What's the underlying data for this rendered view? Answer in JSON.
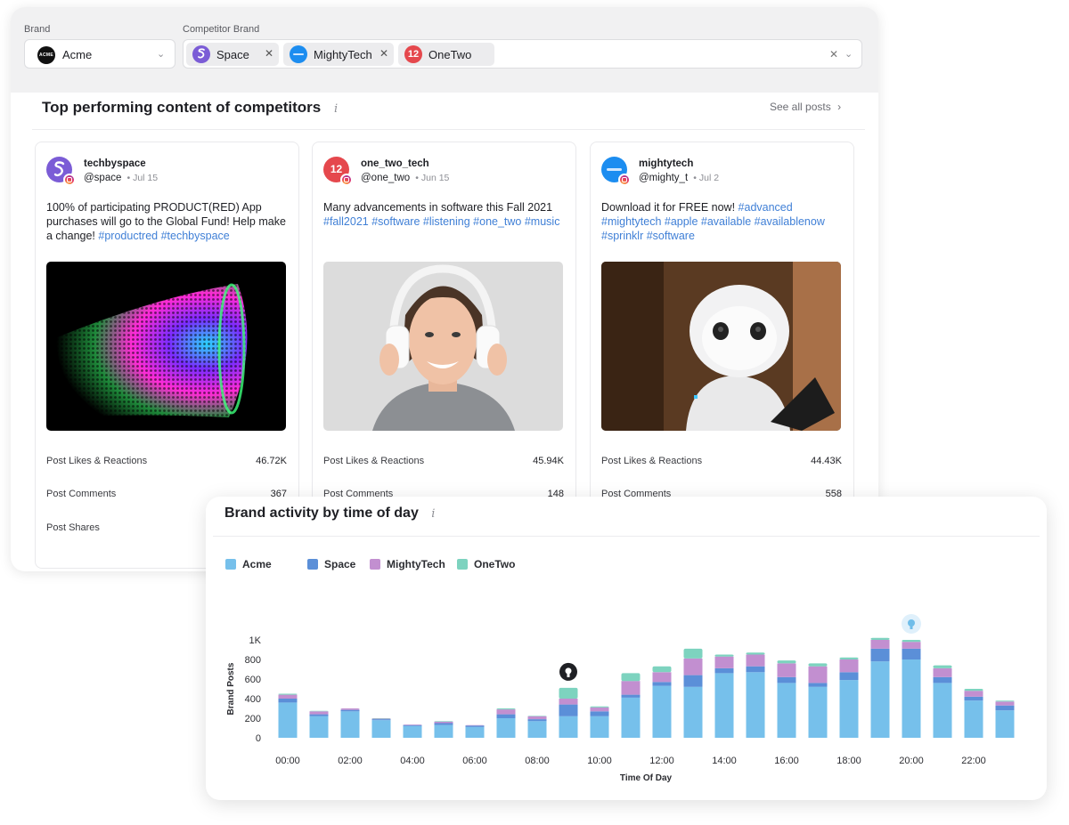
{
  "filters": {
    "brand_label": "Brand",
    "brand_value": "Acme",
    "brand_logo_text": "ACME",
    "competitor_label": "Competitor Brand",
    "competitors": [
      {
        "name": "Space",
        "color": "#7b5cd6",
        "glyph": "S",
        "removable": true
      },
      {
        "name": "MightyTech",
        "color": "#1c8df0",
        "glyph": "M",
        "removable": true
      },
      {
        "name": "OneTwo",
        "color": "#e5484d",
        "glyph": "12",
        "removable": false
      }
    ]
  },
  "content": {
    "title": "Top performing content of competitors",
    "info_glyph": "i",
    "see_all": "See all posts",
    "posts": [
      {
        "user": "techbyspace",
        "handle": "@space",
        "date": "Jul 15",
        "text": "100% of participating PRODUCT(RED) App purchases will go to the Global Fund! Help make a change!",
        "hashtags": "#productred #techbyspace",
        "avatar_color": "#7b5cd6",
        "avatar_glyph": "S",
        "metrics": [
          {
            "label": "Post Likes & Reactions",
            "value": "46.72K"
          },
          {
            "label": "Post Comments",
            "value": "367"
          },
          {
            "label": "Post Shares",
            "value": ""
          }
        ]
      },
      {
        "user": "one_two_tech",
        "handle": "@one_two",
        "date": "Jun 15",
        "text": "Many advancements in software this Fall 2021",
        "hashtags": "#fall2021 #software #listening #one_two #music",
        "avatar_color": "#e5484d",
        "avatar_glyph": "12",
        "metrics": [
          {
            "label": "Post Likes & Reactions",
            "value": "45.94K"
          },
          {
            "label": "Post Comments",
            "value": "148"
          }
        ]
      },
      {
        "user": "mightytech",
        "handle": "@mighty_t",
        "date": "Jul 2",
        "text": "Download it for FREE now!",
        "hashtags": "#advanced #mightytech #apple #available #availablenow #sprinklr #software",
        "avatar_color": "#1c8df0",
        "avatar_glyph": "M",
        "metrics": [
          {
            "label": "Post Likes & Reactions",
            "value": "44.43K"
          },
          {
            "label": "Post Comments",
            "value": "558"
          }
        ]
      }
    ]
  },
  "chart_panel": {
    "title": "Brand activity by time of day",
    "info_glyph": "i"
  },
  "chart_data": {
    "type": "bar",
    "stacked": true,
    "title": "Brand activity by time of day",
    "xlabel": "Time Of Day",
    "ylabel": "Brand Posts",
    "ylim": [
      0,
      1000
    ],
    "y_ticks": [
      "0",
      "200",
      "400",
      "600",
      "800",
      "1K"
    ],
    "x_tick_labels": [
      "00:00",
      "02:00",
      "04:00",
      "06:00",
      "08:00",
      "10:00",
      "12:00",
      "14:00",
      "16:00",
      "18:00",
      "20:00",
      "22:00"
    ],
    "categories": [
      "00:00",
      "01:00",
      "02:00",
      "03:00",
      "04:00",
      "05:00",
      "06:00",
      "07:00",
      "08:00",
      "09:00",
      "10:00",
      "11:00",
      "12:00",
      "13:00",
      "14:00",
      "15:00",
      "16:00",
      "17:00",
      "18:00",
      "19:00",
      "20:00",
      "21:00",
      "22:00",
      "23:00"
    ],
    "series": [
      {
        "name": "Acme",
        "color": "#76c0eb",
        "values": [
          360,
          220,
          270,
          180,
          120,
          130,
          110,
          200,
          170,
          220,
          220,
          410,
          530,
          520,
          660,
          670,
          560,
          520,
          590,
          780,
          800,
          560,
          380,
          280
        ]
      },
      {
        "name": "Space",
        "color": "#5b8fd8",
        "values": [
          40,
          20,
          15,
          10,
          10,
          20,
          15,
          40,
          20,
          120,
          50,
          30,
          40,
          120,
          50,
          60,
          60,
          40,
          80,
          130,
          110,
          60,
          40,
          50
        ]
      },
      {
        "name": "MightyTech",
        "color": "#c28fd0",
        "values": [
          40,
          30,
          15,
          5,
          5,
          15,
          5,
          50,
          30,
          60,
          40,
          140,
          100,
          170,
          120,
          120,
          140,
          170,
          130,
          90,
          70,
          90,
          60,
          40
        ]
      },
      {
        "name": "OneTwo",
        "color": "#7dd3bf",
        "values": [
          10,
          5,
          0,
          5,
          0,
          5,
          0,
          10,
          5,
          110,
          10,
          80,
          60,
          100,
          20,
          20,
          30,
          30,
          20,
          20,
          20,
          30,
          20,
          10
        ]
      }
    ],
    "grid": false,
    "legend_position": "top-left",
    "annotations": [
      {
        "hour_index": 9,
        "type": "insight-marker",
        "style": "dark"
      },
      {
        "hour_index": 20,
        "type": "insight-marker",
        "style": "light"
      }
    ]
  }
}
